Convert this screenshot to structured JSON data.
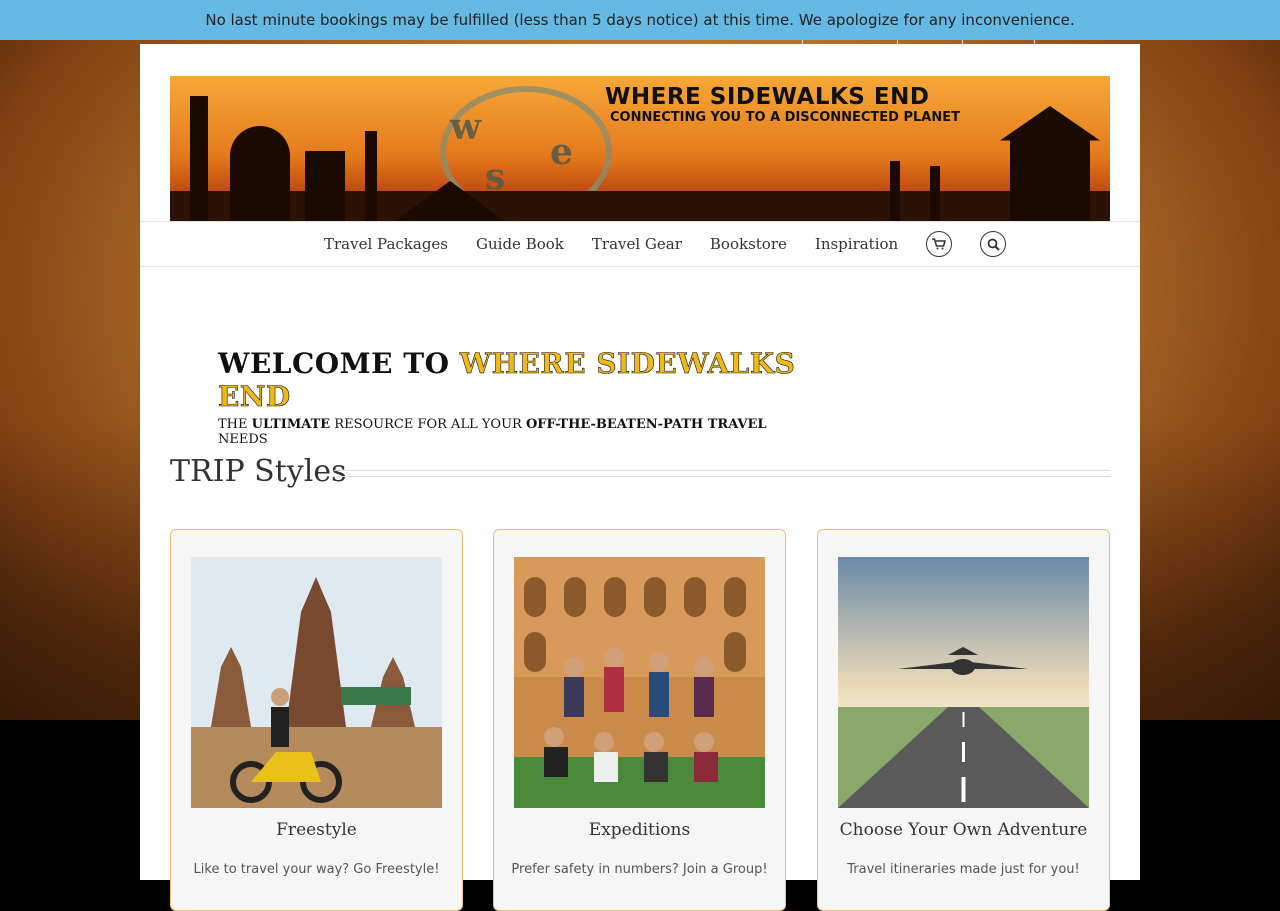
{
  "notice": {
    "text": "No last minute bookings may be fulfilled (less than 5 days notice) at this time. We apologize for any inconvenience."
  },
  "banner": {
    "title": "WHERE SIDEWALKS END",
    "subtitle": "CONNECTING YOU TO A DISCONNECTED PLANET",
    "logo_letters": [
      "w",
      "s",
      "e"
    ]
  },
  "nav": {
    "items": [
      "Travel Packages",
      "Guide Book",
      "Travel Gear",
      "Bookstore",
      "Inspiration"
    ],
    "cart_icon": "cart-icon",
    "search_icon": "search-icon"
  },
  "welcome": {
    "line1_a": "WELCOME TO ",
    "line1_b": "WHERE SIDEWALKS END",
    "line2_a": "THE ",
    "line2_b": "ULTIMATE",
    "line2_c": " RESOURCE FOR ALL YOUR ",
    "line2_d": "OFF-THE-BEATEN-PATH TRAVEL",
    "line2_e": " NEEDS"
  },
  "section": {
    "title": "TRIP Styles"
  },
  "cards": [
    {
      "title": "Freestyle",
      "text": "Like to travel your way? Go Freestyle!"
    },
    {
      "title": "Expeditions",
      "text": "Prefer safety in numbers? Join a Group!"
    },
    {
      "title": "Choose Your Own Adventure",
      "text": "Travel itineraries made just for you!"
    }
  ],
  "colors": {
    "notice_bg": "#65b9e2",
    "card_border": "#f0c070",
    "accent_yellow": "#f1b81c"
  }
}
